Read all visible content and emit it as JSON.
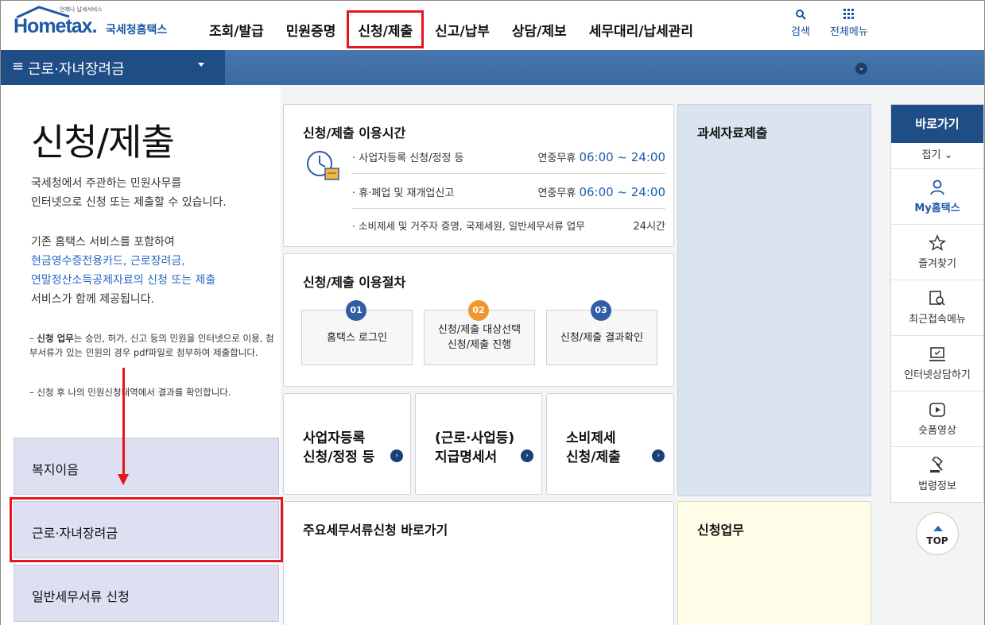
{
  "header": {
    "logo_small": "언제나 납세서비스",
    "logo_main": "Hometax.",
    "logo_sub": "국세청홈택스",
    "nav": [
      "조회/발급",
      "민원증명",
      "신청/제출",
      "신고/납부",
      "상담/제보",
      "세무대리/납세관리"
    ],
    "active_nav": "신청/제출",
    "search_label": "검색",
    "menu_label": "전체메뉴"
  },
  "bluebar": {
    "title": "근로·자녀장려금"
  },
  "left": {
    "page_title": "신청/제출",
    "desc1": [
      "국세청에서 주관하는 민원사무를",
      "인터넷으로 신청 또는 제출할 수 있습니다."
    ],
    "desc2_line1": "기존 홈택스 서비스를 포함하여",
    "desc2_blue1": "현금영수증전용카드, 근로장려금,",
    "desc2_blue2": "연말정산소득공제자료의 신청 또는 제출",
    "desc2_line4": "서비스가 함께 제공됩니다.",
    "note1_bold": "신청 업무",
    "note1_rest": "는 승인, 허가, 신고 등의 민원을 인터넷으로 이용, 첨부서류가 있는 민원의 경우 pdf파일로 첨부하여 제출합니다.",
    "note2": "신청 후 나의 민원신청내역에서 결과를 확인합니다.",
    "menu": [
      "복지이음",
      "근로·자녀장려금",
      "일반세무서류 신청"
    ]
  },
  "hours": {
    "title": "신청/제출 이용시간",
    "rows": [
      {
        "label": "· 사업자등록 신청/정정 등",
        "pre": "연중무휴 ",
        "time": "06:00 ~ 24:00"
      },
      {
        "label": "· 휴·폐업 및 재개업신고",
        "pre": "연중무휴 ",
        "time": "06:00 ~ 24:00"
      },
      {
        "label": "· 소비제세 및 거주자 증명, 국제세원, 일반세무서류 업무",
        "pre": "",
        "time": "24시간"
      }
    ]
  },
  "procedure": {
    "title": "신청/제출 이용절차",
    "steps": [
      {
        "num": "01",
        "text": "홈택스 로그인",
        "color": "#2f5ea3"
      },
      {
        "num": "02",
        "text": "신청/제출 대상선택\n신청/제출 진행",
        "color": "#f0962a"
      },
      {
        "num": "03",
        "text": "신청/제출 결과확인",
        "color": "#2f5ea3"
      }
    ]
  },
  "quick_cards": [
    {
      "line1": "사업자등록",
      "line2": "신청/정정 등"
    },
    {
      "line1": "(근로·사업등)",
      "line2": "지급명세서"
    },
    {
      "line1": "소비제세",
      "line2": "신청/제출"
    }
  ],
  "docs_card": {
    "title": "주요세무서류신청 바로가기"
  },
  "blue_panel": {
    "title": "과세자료제출"
  },
  "yellow_panel": {
    "title": "신청업무"
  },
  "quickbar": {
    "head": "바로가기",
    "fold": "접기",
    "items": [
      {
        "label": "My홈택스",
        "icon": "person-icon"
      },
      {
        "label": "즐겨찾기",
        "icon": "star-icon"
      },
      {
        "label": "최근접속메뉴",
        "icon": "recent-menu-icon"
      },
      {
        "label": "인터넷상담하기",
        "icon": "consult-icon"
      },
      {
        "label": "숏폼영상",
        "icon": "video-icon"
      },
      {
        "label": "법령정보",
        "icon": "gavel-icon"
      }
    ],
    "top_label": "TOP"
  },
  "colors": {
    "brand": "#1c5aa6",
    "annotation": "#e8141c",
    "bar": "#1f4e87"
  }
}
